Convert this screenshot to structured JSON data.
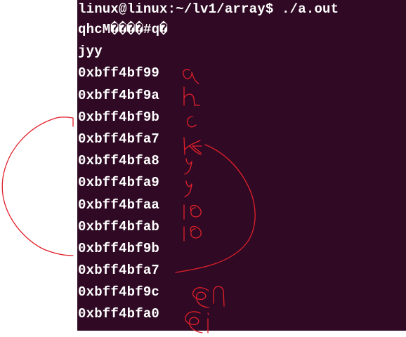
{
  "terminal": {
    "background": "#300a24",
    "text_color": "#ffffff",
    "prompt": "linux@linux:~/lv1/array$ ./a.out",
    "output_lines": [
      "qhcM����#q�",
      "jyy",
      "0xbff4bf99",
      "0xbff4bf9a",
      "0xbff4bf9b",
      "0xbff4bfa7",
      "0xbff4bfa8",
      "0xbff4bfa9",
      "0xbff4bfaa",
      "0xbff4bfab",
      "0xbff4bf9b",
      "0xbff4bfa7",
      "0xbff4bf9c",
      "0xbff4bfa0"
    ]
  },
  "annotations": {
    "ink_color": "#e0202a",
    "handwritten_notes": [
      "a",
      "h",
      "c",
      "k",
      "y",
      "y",
      "10",
      "10",
      "&n",
      "&i"
    ]
  }
}
